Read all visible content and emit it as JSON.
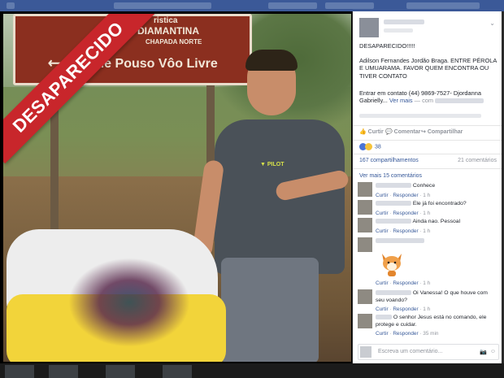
{
  "banner": "DESAPARECIDO",
  "sign": {
    "line1": "ristica",
    "line2": "DIAMANTINA",
    "line3": "CHAPADA NORTE",
    "line4": "ista de Pouso Vôo Livre"
  },
  "shirt_logo": "PILOT",
  "post": {
    "headline": "DESAPARECIDO!!!!!",
    "body": "Adilson Fernandes Jordão Braga. ENTRE PÉROLA E UMUARAMA. FAVOR QUEM ENCONTRA OU TIVER CONTATO",
    "contact": "Entrar em contato (44) 9869-7527- Djordanna Gabrielly...",
    "see_more": "Ver mais",
    "with": " — com"
  },
  "actions": {
    "like": "Curtir",
    "comment": "Comentar",
    "share": "Compartilhar"
  },
  "reactions": {
    "count": "38"
  },
  "stats": {
    "shares": "167 compartilhamentos",
    "comments": "21 comentários"
  },
  "more_comments": "Ver mais 15 comentários",
  "comments": [
    {
      "text": "Conhece",
      "meta": "1 h"
    },
    {
      "text": "Ele já foi encontrado?",
      "meta": "1 h"
    },
    {
      "text": "Ainda nao. Pessoal",
      "meta": "1 h"
    },
    {
      "text": "",
      "meta": "1 h"
    },
    {
      "text": "Oi Vanessa! O que houve com seu voando?",
      "meta": "1 h"
    },
    {
      "text": "O senhor Jesus está no comando, ele protege e cuidar.",
      "meta": "35 min"
    }
  ],
  "comment_action_like": "Curtir",
  "comment_action_reply": "Responder",
  "write_placeholder": "Escreva um comentário...",
  "colors": {
    "facebook_blue": "#3b5998",
    "link": "#365899",
    "banner_red": "#c8262b",
    "sign_brown": "#8b2f1f"
  }
}
